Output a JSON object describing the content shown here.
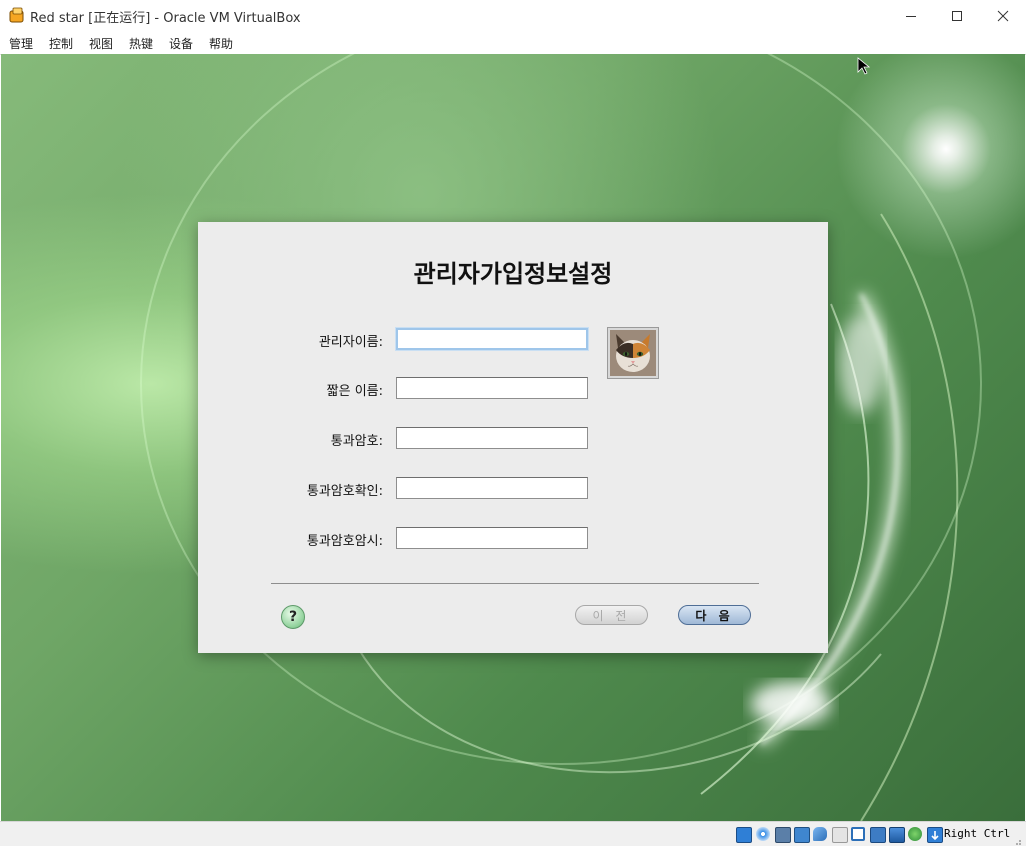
{
  "window": {
    "title": "Red star [正在运行] - Oracle VM VirtualBox",
    "controls": [
      "minimize-icon",
      "maximize-icon",
      "close-icon"
    ]
  },
  "menubar": {
    "items": [
      "管理",
      "控制",
      "视图",
      "热键",
      "设备",
      "帮助"
    ]
  },
  "dialog": {
    "title": "관리자가입정보설정",
    "fields": [
      {
        "label": "관리자이름:",
        "value": "",
        "focused": true
      },
      {
        "label": "짧은 이름:",
        "value": ""
      },
      {
        "label": "통과암호:",
        "value": ""
      },
      {
        "label": "통과암호확인:",
        "value": ""
      },
      {
        "label": "통과암호암시:",
        "value": ""
      }
    ],
    "avatar": "cat-photo",
    "help_label": "?",
    "prev_label": "이 전",
    "next_label": "다 음"
  },
  "statusbar": {
    "icons": [
      "hard-disk-icon",
      "optical-drive-icon",
      "audio-icon",
      "network-icon",
      "usb-icon",
      "shared-folders-icon",
      "display-icon",
      "video-capture-icon",
      "guest-additions-icon",
      "cpu-icon",
      "mouse-integration-icon",
      "keyboard-capture-icon"
    ],
    "host_key": "Right Ctrl"
  },
  "colors": {
    "desktop_green": "#6fa666",
    "dialog_bg": "#ececec",
    "next_button": "#9fb8d6"
  }
}
